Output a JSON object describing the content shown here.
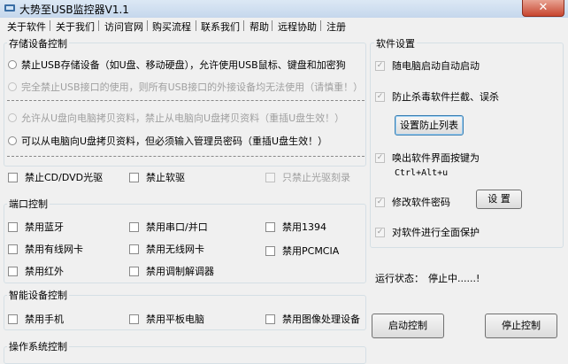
{
  "window": {
    "title": "大势至USB监控器V1.1",
    "close_glyph": "✕"
  },
  "menu": [
    "关于软件",
    "关于我们",
    "访问官网",
    "购买流程",
    "联系我们",
    "帮助",
    "远程协助",
    "注册"
  ],
  "storage": {
    "group_label": "存储设备控制",
    "options": [
      "禁止USB存储设备（如U盘、移动硬盘），允许使用USB鼠标、键盘和加密狗",
      "完全禁止USB接口的使用，则所有USB接口的外接设备均无法使用（请慎重！）",
      "允许从U盘向电脑拷贝资料，禁止从电脑向U盘拷贝资料（重插U盘生效！）",
      "可以从电脑向U盘拷贝资料，但必须输入管理员密码（重插U盘生效！）"
    ],
    "checks": [
      "禁止CD/DVD光驱",
      "禁止软驱",
      "只禁止光驱刻录"
    ]
  },
  "ports": {
    "group_label": "端口控制",
    "checks": [
      "禁用蓝牙",
      "禁用串口/并口",
      "禁用1394",
      "禁用有线网卡",
      "禁用无线网卡",
      "禁用PCMCIA",
      "禁用红外",
      "禁用调制解调器"
    ]
  },
  "smart": {
    "group_label": "智能设备控制",
    "checks": [
      "禁用手机",
      "禁用平板电脑",
      "禁用图像处理设备"
    ]
  },
  "os": {
    "group_label": "操作系统控制"
  },
  "settings": {
    "group_label": "软件设置",
    "autostart": "随电脑启动自动启动",
    "antikill": "防止杀毒软件拦截、误杀",
    "set_antikill_btn": "设置防止列表",
    "hotkey_label": "唤出软件界面按键为",
    "hotkey": "Ctrl+Alt+u",
    "change_pwd": "修改软件密码",
    "pwd_btn": "设 置",
    "full_protect": "对软件进行全面保护",
    "check_mark": "✓"
  },
  "status": {
    "label": "运行状态：",
    "value": "停止中......!"
  },
  "actions": {
    "start": "启动控制",
    "stop": "停止控制"
  }
}
